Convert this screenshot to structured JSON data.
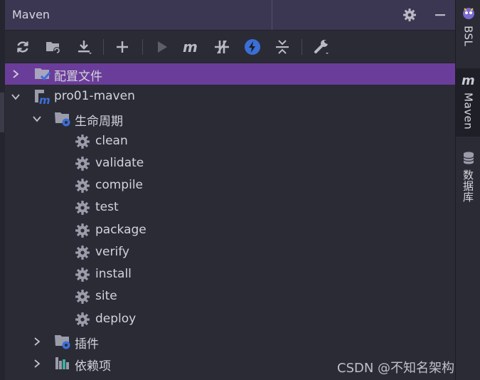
{
  "header": {
    "title": "Maven"
  },
  "colors": {
    "accent": "#6b3d9a",
    "background": "#2b2b36",
    "header": "#3b3652",
    "icon_blue": "#3b6fd6"
  },
  "toolbar": {
    "buttons": [
      "reload-icon",
      "generate-sources-icon",
      "download-icon",
      "add-icon",
      "run-icon",
      "maven-m-icon",
      "toggle-offline-icon",
      "lightning-icon",
      "collapse-all-icon",
      "wrench-icon"
    ]
  },
  "tree": {
    "config": {
      "label": "配置文件"
    },
    "project": {
      "label": "pro01-maven"
    },
    "lifecycle": {
      "label": "生命周期",
      "items": [
        "clean",
        "validate",
        "compile",
        "test",
        "package",
        "verify",
        "install",
        "site",
        "deploy"
      ]
    },
    "plugins": {
      "label": "插件"
    },
    "dependencies": {
      "label": "依赖项"
    }
  },
  "right_tabs": [
    {
      "label": "BSL",
      "icon": "bsl-icon"
    },
    {
      "label": "Maven",
      "icon": "maven-m-icon",
      "active": true
    },
    {
      "label": "数据库",
      "icon": "database-icon"
    }
  ],
  "watermark": "CSDN @不知名架构师"
}
